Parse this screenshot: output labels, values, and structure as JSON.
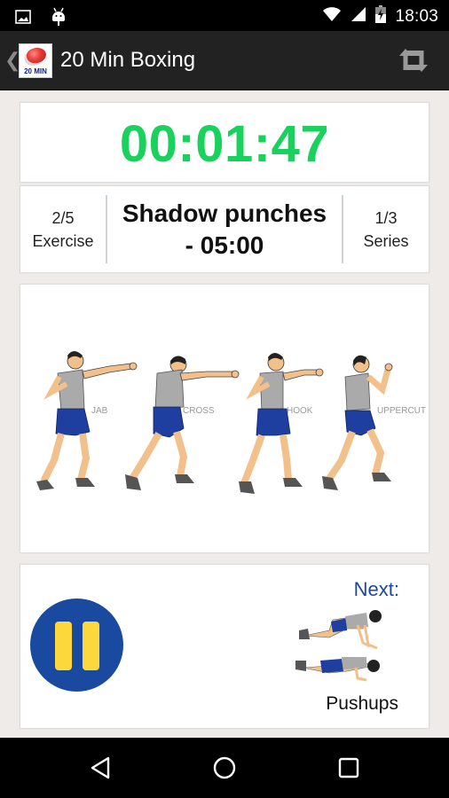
{
  "status_bar": {
    "time": "18:03",
    "left_icons": [
      "image-notification-icon",
      "android-debug-icon"
    ],
    "right_icons": [
      "wifi-icon",
      "signal-icon",
      "battery-charging-icon"
    ]
  },
  "action_bar": {
    "up_icon": "chevron-left-icon",
    "logo_text": "20 MIN",
    "title": "20 Min Boxing",
    "action_icon": "repeat-icon"
  },
  "timer": {
    "value": "00:01:47",
    "color": "#19d15d"
  },
  "exercise_info": {
    "exercise_progress": "2/5",
    "exercise_label": "Exercise",
    "name_line1": "Shadow punches",
    "name_line2": "- 05:00",
    "series_progress": "1/3",
    "series_label": "Series"
  },
  "illustration": {
    "moves": [
      "JAB",
      "CROSS",
      "HOOK",
      "UPPERCUT"
    ]
  },
  "controls": {
    "pause_icon": "pause-icon",
    "pause_color": "#1a4aa0",
    "pause_bar_color": "#fdd83c",
    "next_label": "Next:",
    "next_exercise": "Pushups"
  },
  "nav_bar": {
    "buttons": [
      "back-icon",
      "home-icon",
      "recents-icon"
    ]
  }
}
